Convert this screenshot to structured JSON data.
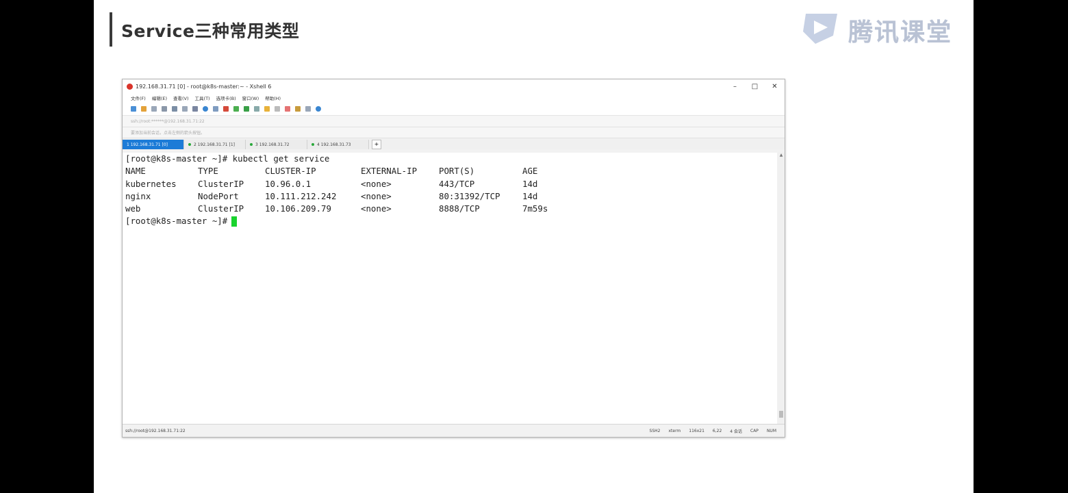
{
  "slide": {
    "title": "Service三种常用类型",
    "logo_text": "腾讯课堂"
  },
  "window": {
    "title": "192.168.31.71 [0] - root@k8s-master:~ - Xshell 6",
    "controls": [
      "–",
      "□",
      "✕"
    ],
    "menu": [
      "文件(F)",
      "编辑(E)",
      "查看(V)",
      "工具(T)",
      "选项卡(B)",
      "窗口(W)",
      "帮助(H)"
    ],
    "address": "ssh://root:******@192.168.31.71:22",
    "note": "要添加当前会话，点击左侧的箭头按钮。",
    "tabs": [
      {
        "label": "1 192.168.31.71 [0]",
        "active": true
      },
      {
        "label": "2 192.168.31.71 [1]",
        "active": false
      },
      {
        "label": "3 192.168.31.72",
        "active": false
      },
      {
        "label": "4 192.168.31.73",
        "active": false
      }
    ],
    "tab_add": "+",
    "status": {
      "connection": "ssh://root@192.168.31.71:22",
      "protocol": "SSH2",
      "term": "xterm",
      "size": "116x21",
      "pos": "6,22",
      "sessions": "4 会话",
      "caps": "CAP",
      "num": "NUM"
    }
  },
  "terminal": {
    "command_line": "[root@k8s-master ~]# kubectl get service",
    "headers": [
      "NAME",
      "TYPE",
      "CLUSTER-IP",
      "EXTERNAL-IP",
      "PORT(S)",
      "AGE"
    ],
    "rows": [
      [
        "kubernetes",
        "ClusterIP",
        "10.96.0.1",
        "<none>",
        "443/TCP",
        "14d"
      ],
      [
        "nginx",
        "NodePort",
        "10.111.212.242",
        "<none>",
        "80:31392/TCP",
        "14d"
      ],
      [
        "web",
        "ClusterIP",
        "10.106.209.79",
        "<none>",
        "8888/TCP",
        "7m59s"
      ]
    ],
    "prompt": "[root@k8s-master ~]#"
  },
  "colors": {
    "tab_active": "#1c7bd7",
    "cursor": "#19d32e",
    "logo": "#b9c2d4"
  }
}
